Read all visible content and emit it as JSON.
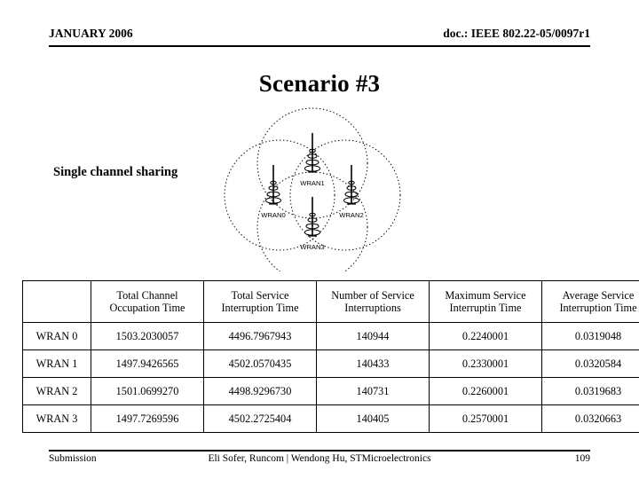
{
  "header": {
    "left": "JANUARY 2006",
    "right": "doc.: IEEE 802.22-05/0097r1"
  },
  "title": "Scenario #3",
  "caption": "Single channel sharing",
  "diagram": {
    "name": "wran-coverage-overlap-diagram",
    "nodes": [
      {
        "label": "WRAN1",
        "position": "top"
      },
      {
        "label": "WRAN0",
        "position": "left"
      },
      {
        "label": "WRAN2",
        "position": "right"
      },
      {
        "label": "WRAN3",
        "position": "bottom"
      }
    ],
    "circle_style": "dotted",
    "circle_color": "#000000"
  },
  "table": {
    "corner_label": "",
    "columns": [
      {
        "line1": "Total Channel",
        "line2": "Occupation Time"
      },
      {
        "line1": "Total Service",
        "line2": "Interruption Time"
      },
      {
        "line1": "Number of Service",
        "line2": "Interruptions"
      },
      {
        "line1": "Maximum Service",
        "line2": "Interruptin Time"
      },
      {
        "line1": "Average Service",
        "line2": "Interruption Time"
      }
    ],
    "rows": [
      {
        "label": "WRAN 0",
        "total_channel_occupation_time": "1503.2030057",
        "total_service_interruption_time": "4496.7967943",
        "number_of_service_interruptions": "140944",
        "maximum_service_interruption_time": "0.2240001",
        "average_service_interruption_time": "0.0319048"
      },
      {
        "label": "WRAN 1",
        "total_channel_occupation_time": "1497.9426565",
        "total_service_interruption_time": "4502.0570435",
        "number_of_service_interruptions": "140433",
        "maximum_service_interruption_time": "0.2330001",
        "average_service_interruption_time": "0.0320584"
      },
      {
        "label": "WRAN 2",
        "total_channel_occupation_time": "1501.0699270",
        "total_service_interruption_time": "4498.9296730",
        "number_of_service_interruptions": "140731",
        "maximum_service_interruption_time": "0.2260001",
        "average_service_interruption_time": "0.0319683"
      },
      {
        "label": "WRAN 3",
        "total_channel_occupation_time": "1497.7269596",
        "total_service_interruption_time": "4502.2725404",
        "number_of_service_interruptions": "140405",
        "maximum_service_interruption_time": "0.2570001",
        "average_service_interruption_time": "0.0320663"
      }
    ]
  },
  "footer": {
    "left": "Submission",
    "center": "Eli Sofer, Runcom  |   Wendong Hu, STMicroelectronics",
    "right": "109"
  }
}
